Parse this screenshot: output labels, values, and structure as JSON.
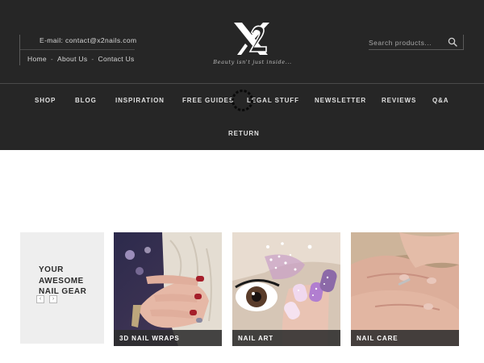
{
  "header": {
    "email_text": "E-mail: contact@x2nails.com",
    "top_links": [
      "Home",
      "About Us",
      "Contact Us"
    ],
    "link_separator": "-",
    "logo_alt": "X2",
    "tagline": "Beauty isn't just inside...",
    "search": {
      "placeholder": "Search products...",
      "icon": "search-icon"
    }
  },
  "nav": {
    "items": [
      "SHOP",
      "BLOG",
      "INSPIRATION",
      "FREE GUIDES",
      "LEGAL STUFF",
      "NEWSLETTER",
      "REVIEWS",
      "Q&A",
      "RETURN"
    ],
    "loading_icon": "spinner-icon"
  },
  "gear": {
    "title_lines": [
      "YOUR",
      "AWESOME",
      "NAIL GEAR"
    ],
    "prev_icon": "chevron-left-icon",
    "next_icon": "chevron-right-icon",
    "prev_label": "‹",
    "next_label": "›"
  },
  "cards": [
    {
      "caption": "3D NAIL WRAPS"
    },
    {
      "caption": "NAIL ART"
    },
    {
      "caption": "NAIL CARE"
    }
  ],
  "colors": {
    "header_bg": "#262626",
    "nav_text": "#e0e0e0",
    "gear_bg": "#eeeeee",
    "caption_bg": "#2d2d2d"
  }
}
